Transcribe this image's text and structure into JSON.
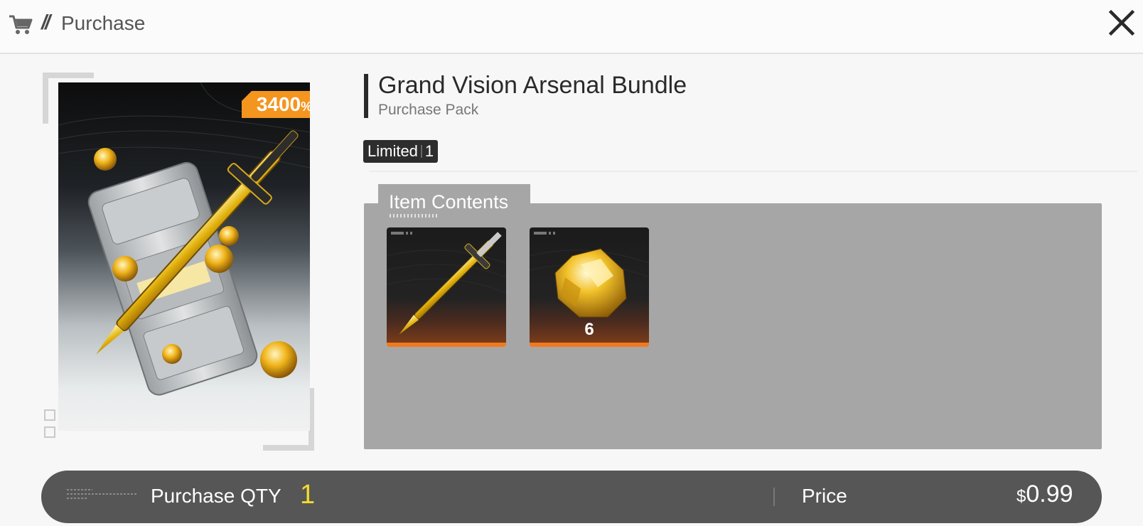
{
  "header": {
    "slash": "//",
    "title": "Purchase",
    "cart_icon": "cart-icon",
    "close_icon": "close-icon"
  },
  "product": {
    "discount_value": "3400",
    "discount_unit": "%",
    "title": "Grand Vision Arsenal Bundle",
    "subtitle": "Purchase Pack",
    "limited_label": "Limited",
    "limited_count": "1"
  },
  "contents": {
    "tab_label": "Item Contents",
    "items": [
      {
        "icon": "golden-sword-icon",
        "qty": ""
      },
      {
        "icon": "gold-crystal-icon",
        "qty": "6"
      }
    ]
  },
  "purchase_bar": {
    "qty_label": "Purchase QTY",
    "qty_value": "1",
    "price_label": "Price",
    "price_currency": "$",
    "price_amount": "0.99"
  },
  "colors": {
    "accent_orange": "#f4951f",
    "qty_yellow": "#f2dc2b",
    "bar_gray": "#565656",
    "panel_gray": "#a6a6a6"
  }
}
